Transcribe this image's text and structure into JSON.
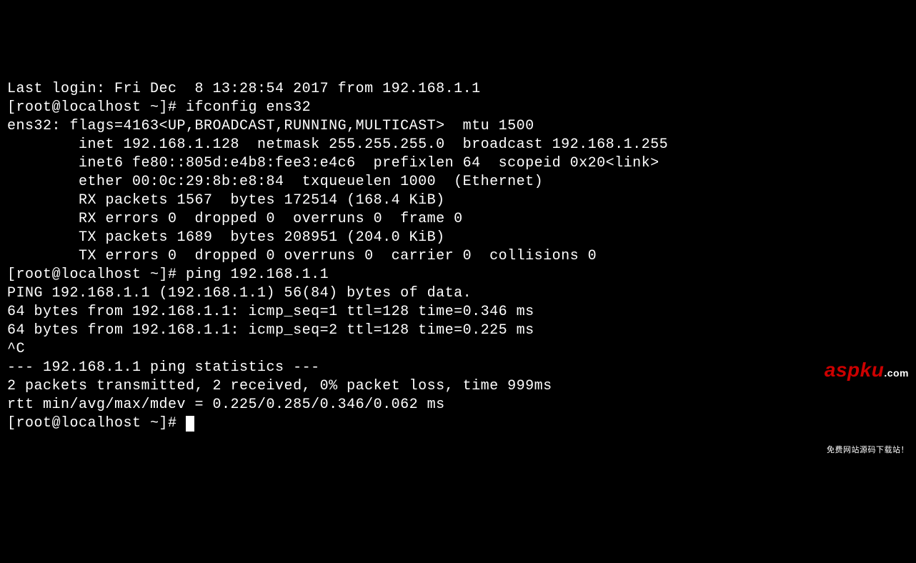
{
  "terminal": {
    "lines": [
      "Last login: Fri Dec  8 13:28:54 2017 from 192.168.1.1",
      "[root@localhost ~]# ifconfig ens32",
      "ens32: flags=4163<UP,BROADCAST,RUNNING,MULTICAST>  mtu 1500",
      "        inet 192.168.1.128  netmask 255.255.255.0  broadcast 192.168.1.255",
      "        inet6 fe80::805d:e4b8:fee3:e4c6  prefixlen 64  scopeid 0x20<link>",
      "        ether 00:0c:29:8b:e8:84  txqueuelen 1000  (Ethernet)",
      "        RX packets 1567  bytes 172514 (168.4 KiB)",
      "        RX errors 0  dropped 0  overruns 0  frame 0",
      "        TX packets 1689  bytes 208951 (204.0 KiB)",
      "        TX errors 0  dropped 0 overruns 0  carrier 0  collisions 0",
      "",
      "[root@localhost ~]# ping 192.168.1.1",
      "PING 192.168.1.1 (192.168.1.1) 56(84) bytes of data.",
      "64 bytes from 192.168.1.1: icmp_seq=1 ttl=128 time=0.346 ms",
      "64 bytes from 192.168.1.1: icmp_seq=2 ttl=128 time=0.225 ms",
      "^C",
      "--- 192.168.1.1 ping statistics ---",
      "2 packets transmitted, 2 received, 0% packet loss, time 999ms",
      "rtt min/avg/max/mdev = 0.225/0.285/0.346/0.062 ms",
      "[root@localhost ~]# "
    ]
  },
  "watermark": {
    "brand_red": "aspku",
    "brand_suffix": ".com",
    "tagline": "免费网站源码下载站！"
  }
}
